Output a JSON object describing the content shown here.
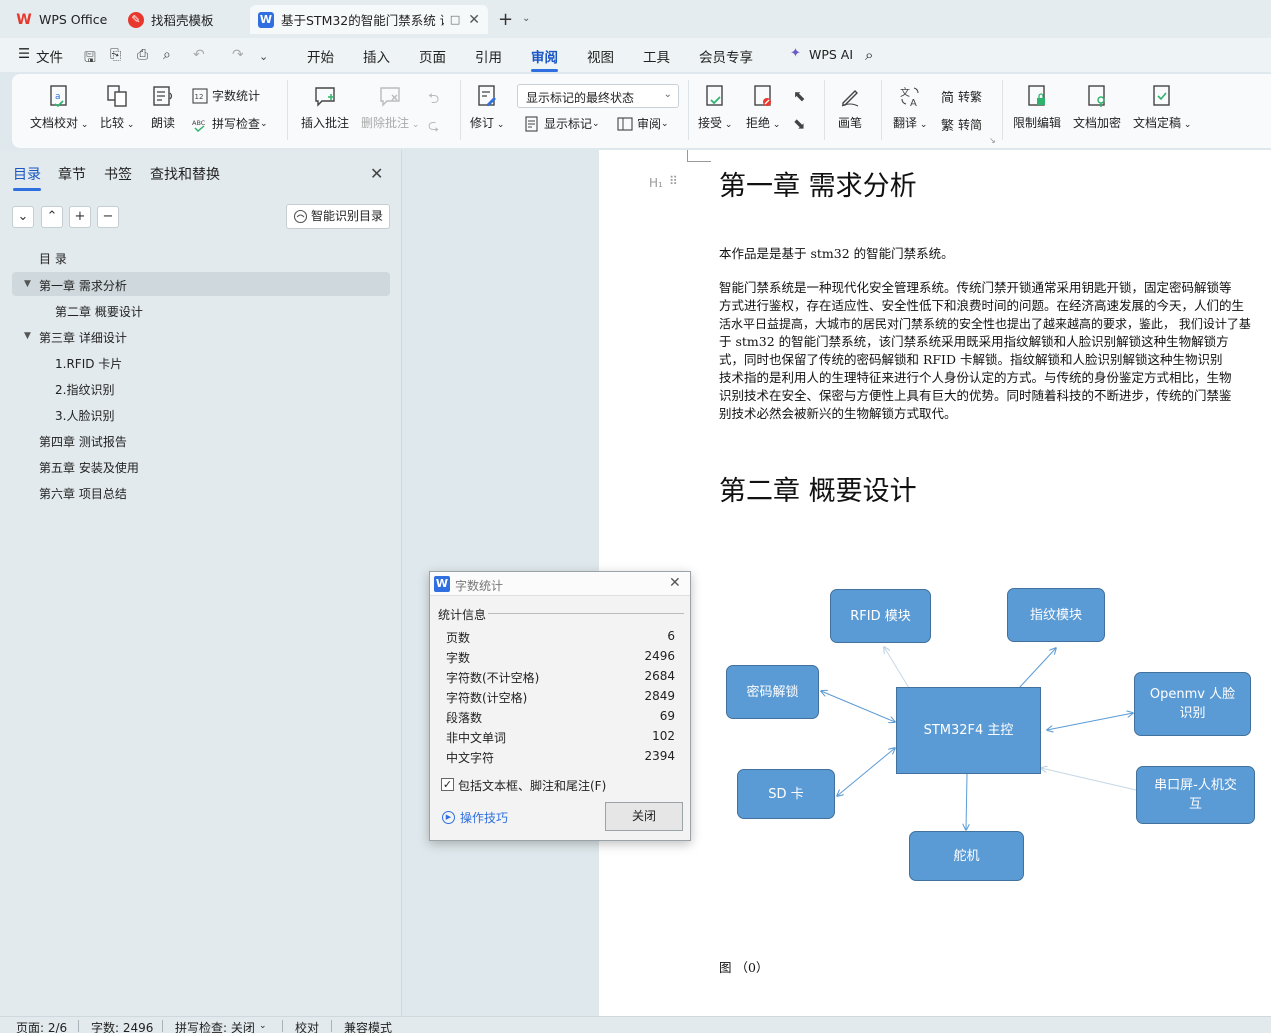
{
  "tabs": [
    {
      "label": "WPS Office",
      "logo": "W",
      "color": "#e8372c"
    },
    {
      "label": "找稻壳模板",
      "logo": "稻",
      "color": "#e8372c"
    },
    {
      "label": "基于STM32的智能门禁系统 课",
      "logo": "W",
      "color": "#2f6fe0",
      "extra": "□"
    }
  ],
  "menu": {
    "file": "文件",
    "items": [
      "开始",
      "插入",
      "页面",
      "引用",
      "审阅",
      "视图",
      "工具",
      "会员专享"
    ],
    "active": "审阅",
    "wps_ai": "WPS AI"
  },
  "ribbon": {
    "doc_check": "文档校对",
    "compare": "比较",
    "read_aloud": "朗读",
    "word_count": "字数统计",
    "spell_check": "拼写检查",
    "insert_comment": "插入批注",
    "delete_comment": "删除批注",
    "revise": "修订",
    "markup_state": "显示标记的最终状态",
    "show_markup": "显示标记",
    "review": "审阅",
    "accept": "接受",
    "reject": "拒绝",
    "pen": "画笔",
    "translate": "翻译",
    "to_traditional": "转繁",
    "to_simplified": "转简",
    "simp_char": "简",
    "trad_char": "繁",
    "restrict_edit": "限制编辑",
    "doc_encrypt": "文档加密",
    "doc_finalize": "文档定稿"
  },
  "nav": {
    "tabs": [
      "目录",
      "章节",
      "书签",
      "查找和替换"
    ],
    "active": "目录",
    "smart_toc": "智能识别目录",
    "toc": [
      {
        "label": "目 录",
        "level": 1
      },
      {
        "label": "第一章 需求分析",
        "level": 1,
        "expanded": true,
        "selected": true
      },
      {
        "label": "第二章 概要设计",
        "level": 2
      },
      {
        "label": "第三章 详细设计",
        "level": 1,
        "expanded": true
      },
      {
        "label": "1.RFID 卡片",
        "level": 2
      },
      {
        "label": "2.指纹识别",
        "level": 2
      },
      {
        "label": "3.人脸识别",
        "level": 2
      },
      {
        "label": "第四章 测试报告",
        "level": 1
      },
      {
        "label": "第五章 安装及使用",
        "level": 1
      },
      {
        "label": "第六章 项目总结",
        "level": 1
      }
    ]
  },
  "doc": {
    "heading_marker": "H₁",
    "h1": "第一章 需求分析",
    "intro": "本作品是是基于 stm32 的智能门禁系统。",
    "para_lines": [
      "智能门禁系统是一种现代化安全管理系统。传统门禁开锁通常采用钥匙开锁，固定密码解锁等",
      "方式进行鉴权，存在适应性、安全性低下和浪费时间的问题。在经济高速发展的今天，人们的生",
      "活水平日益提高，大城市的居民对门禁系统的安全性也提出了越来越高的要求，鉴此，  我们设计了基",
      "于 stm32 的智能门禁系统，该门禁系统采用既采用指纹解锁和人脸识别解锁这种生物解锁方",
      "式，同时也保留了传统的密码解锁和 RFID 卡解锁。指纹解锁和人脸识别解锁这种生物识别",
      "技术指的是利用人的生理特征来进行个人身份认定的方式。与传统的身份鉴定方式相比，生物",
      "识别技术在安全、保密与方便性上具有巨大的优势。同时随着科技的不断进步，传统的门禁鉴",
      "别技术必然会被新兴的生物解锁方式取代。"
    ],
    "h2": "第二章 概要设计",
    "diagram": {
      "center": "STM32F4 主控",
      "rfid": "RFID 模块",
      "fingerprint": "指纹模块",
      "password": "密码解锁",
      "openmv_l1": "Openmv 人脸",
      "openmv_l2": "识别",
      "sd": "SD 卡",
      "screen_l1": "串口屏-人机交",
      "screen_l2": "互",
      "servo": "舵机"
    },
    "figure_caption": "图 （0）"
  },
  "dialog": {
    "title": "字数统计",
    "section": "统计信息",
    "rows": [
      {
        "label": "页数",
        "value": "6"
      },
      {
        "label": "字数",
        "value": "2496"
      },
      {
        "label": "字符数(不计空格)",
        "value": "2684"
      },
      {
        "label": "字符数(计空格)",
        "value": "2849"
      },
      {
        "label": "段落数",
        "value": "69"
      },
      {
        "label": "非中文单词",
        "value": "102"
      },
      {
        "label": "中文字符",
        "value": "2394"
      }
    ],
    "checkbox_label": "包括文本框、脚注和尾注(F)",
    "checkbox_checked": true,
    "tips": "操作技巧",
    "close_btn": "关闭"
  },
  "status": {
    "page": "页面: 2/6",
    "words": "字数: 2496",
    "spell": "拼写检查: 关闭",
    "proof": "校对",
    "compat": "兼容模式"
  },
  "colors": {
    "accent": "#2f6fe0",
    "diagram_fill": "#5b9bd5",
    "diagram_border": "#41719c"
  }
}
